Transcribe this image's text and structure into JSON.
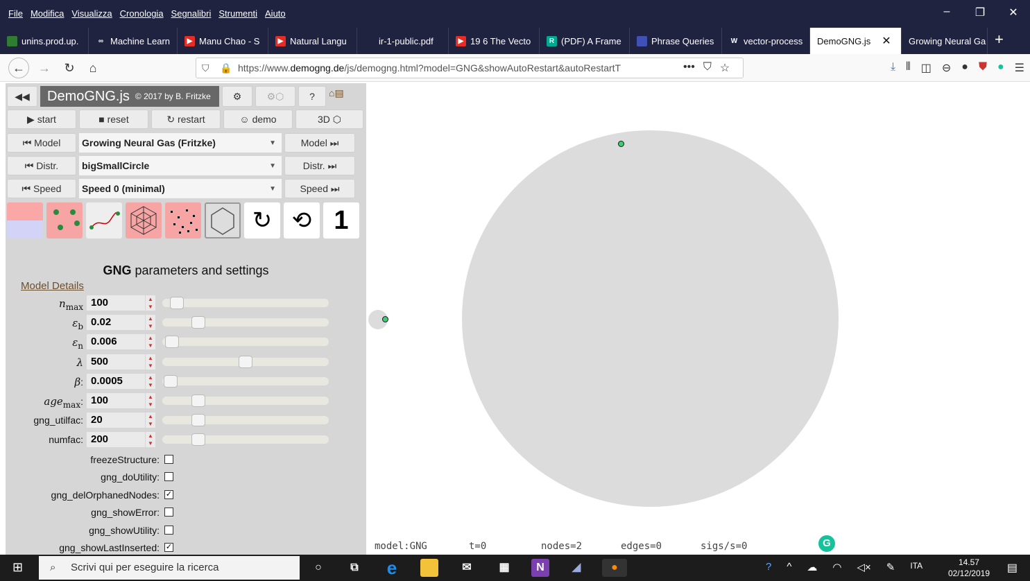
{
  "menu": [
    "File",
    "Modifica",
    "Visualizza",
    "Cronologia",
    "Segnalibri",
    "Strumenti",
    "Aiuto"
  ],
  "tabs": [
    {
      "label": "unins.prod.up.",
      "fav_color": "#2e7d32",
      "width": 128
    },
    {
      "label": "Machine Learn",
      "fav_color": "#202340",
      "fav_glyph": "∞",
      "width": 128
    },
    {
      "label": "Manu Chao - S",
      "fav_color": "#e52d27",
      "fav_glyph": "▶",
      "width": 131
    },
    {
      "label": "Natural Langu",
      "fav_color": "#e52d27",
      "fav_glyph": "▶",
      "width": 128
    },
    {
      "label": "ir-1-public.pdf",
      "fav_color": "#202340",
      "width": 132
    },
    {
      "label": "19 6 The Vecto",
      "fav_color": "#e52d27",
      "fav_glyph": "▶",
      "width": 131
    },
    {
      "label": "(PDF) A Frame",
      "fav_color": "#00a98f",
      "fav_glyph": "R",
      "width": 130
    },
    {
      "label": "Phrase Queries",
      "fav_color": "#3f51b5",
      "width": 133
    },
    {
      "label": "vector-process",
      "fav_color": "#202340",
      "fav_glyph": "W",
      "width": 127
    },
    {
      "label": "DemoGNG.js",
      "fav_color": "",
      "width": 132,
      "active": true
    },
    {
      "label": "Growing Neural Ga",
      "fav_color": "",
      "width": 124
    }
  ],
  "url": {
    "prefix": "https://www.",
    "domain": "demogng.de",
    "rest": "/js/demogng.html?model=GNG&showAutoRestart&autoRestartT"
  },
  "panel": {
    "title": "DemoGNG.js",
    "copyright": "© 2017 by B. Fritzke",
    "buttons": {
      "start": "▶ start",
      "reset": "■ reset",
      "restart": "↻ restart",
      "demo": "☺ demo",
      "three_d": "3D ⬡"
    },
    "rows": [
      {
        "prev": "⏮ Model",
        "value": "Growing Neural Gas (Fritzke)",
        "next": "Model ⏭"
      },
      {
        "prev": "⏮ Distr.",
        "value": "bigSmallCircle",
        "next": "Distr. ⏭"
      },
      {
        "prev": "⏮ Speed",
        "value": "Speed 0 (minimal)",
        "next": "Speed ⏭"
      }
    ],
    "vis_counter": "1",
    "section_title_bold": "GNG",
    "section_title_rest": " parameters and settings",
    "model_details": "Model Details",
    "params": [
      {
        "label": "n",
        "sub": "max",
        "value": "100",
        "pos": 0.05
      },
      {
        "label": "ε",
        "sub": "b",
        "value": "0.02",
        "pos": 0.19
      },
      {
        "label": "ε",
        "sub": "n",
        "value": "0.006",
        "pos": 0.02
      },
      {
        "label": "λ",
        "sub": "",
        "value": "500",
        "pos": 0.5
      },
      {
        "label": "β",
        "sub": "",
        "value": "0.0005",
        "pos": 0.01,
        "colon": true
      },
      {
        "label": "age",
        "sub": "max",
        "value": "100",
        "pos": 0.19,
        "colon": true
      },
      {
        "label": "gng_utilfac:",
        "sub": "",
        "value": "20",
        "pos": 0.19,
        "plain": true
      },
      {
        "label": "numfac:",
        "sub": "",
        "value": "200",
        "pos": 0.19,
        "plain": true
      }
    ],
    "checks": [
      {
        "label": "freezeStructure:",
        "checked": false
      },
      {
        "label": "gng_doUtility:",
        "checked": false
      },
      {
        "label": "gng_delOrphanedNodes:",
        "checked": true
      },
      {
        "label": "gng_showError:",
        "checked": false
      },
      {
        "label": "gng_showUtility:",
        "checked": false
      },
      {
        "label": "gng_showLastInserted:",
        "checked": true
      }
    ]
  },
  "status": {
    "model": "model:GNG",
    "t": "t=0",
    "nodes": "nodes=2",
    "edges": "edges=0",
    "sigs": "sigs/s=0"
  },
  "taskbar": {
    "search_placeholder": "Scrivi qui per eseguire la ricerca",
    "lang": "ITA",
    "time": "14.57",
    "date": "02/12/2019"
  },
  "colors": {
    "chrome": "#202340",
    "panel": "#d6d6d6",
    "node": "#44cc66",
    "circle": "#dcdcdc"
  }
}
